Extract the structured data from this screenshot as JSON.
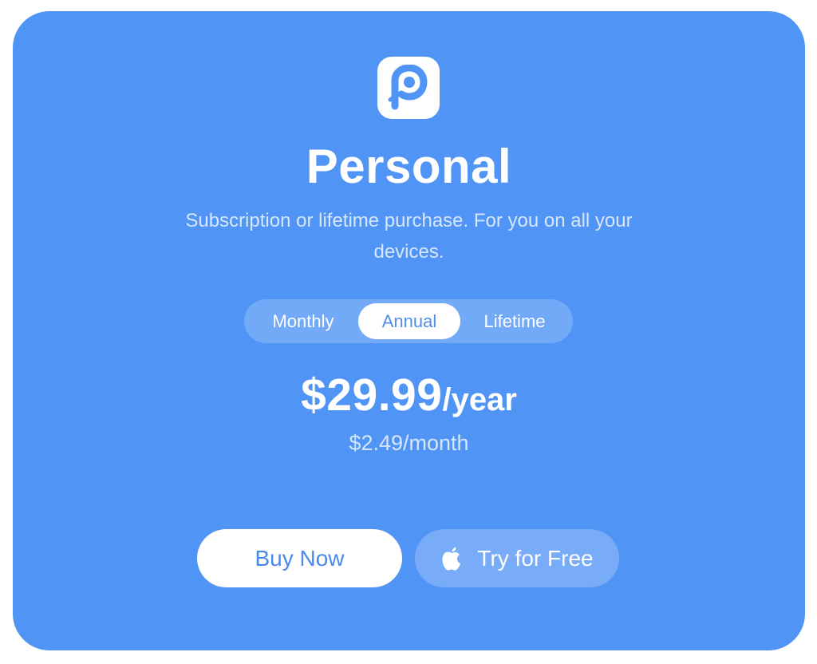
{
  "card": {
    "title": "Personal",
    "subtitle": "Subscription or lifetime purchase. For you on all your devices.",
    "logo_icon": "p-app-logo-icon",
    "background_color": "#5094f5"
  },
  "plan_toggle": {
    "options": [
      {
        "label": "Monthly",
        "selected": false
      },
      {
        "label": "Annual",
        "selected": true
      },
      {
        "label": "Lifetime",
        "selected": false
      }
    ]
  },
  "pricing": {
    "amount": "$29.99",
    "unit": "/year",
    "per_month": "$2.49/month"
  },
  "actions": {
    "buy_label": "Buy Now",
    "try_label": "Try for Free",
    "try_icon": "apple-icon"
  }
}
